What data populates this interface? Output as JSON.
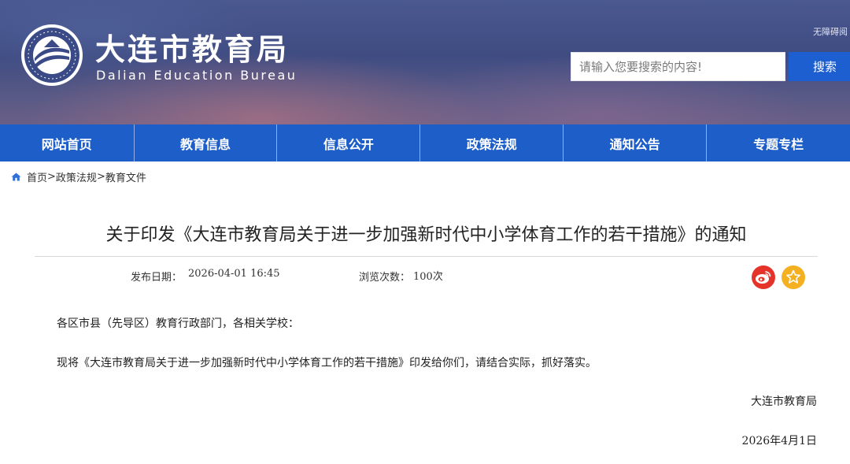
{
  "header": {
    "site_name": "大连市教育局",
    "site_name_en": "Dalian Education Bureau",
    "accessibility_link": "无障碍阅",
    "search": {
      "placeholder": "请输入您要搜索的内容!",
      "button_label": "搜索"
    },
    "banner_color": "#44538a",
    "accent_color": "#1e5ec9"
  },
  "nav": {
    "items": [
      {
        "label": "网站首页"
      },
      {
        "label": "教育信息"
      },
      {
        "label": "信息公开"
      },
      {
        "label": "政策法规"
      },
      {
        "label": "通知公告"
      },
      {
        "label": "专题专栏"
      }
    ]
  },
  "breadcrumb": {
    "icon": "home-icon",
    "items": [
      "首页",
      "政策法规",
      "教育文件"
    ],
    "separator": ">"
  },
  "article": {
    "title": "关于印发《大连市教育局关于进一步加强新时代中小学体育工作的若干措施》的通知",
    "publish_label": "发布日期：",
    "publish_date": "2026-04-01  16:45",
    "views_label": "浏览次数：",
    "views": "100次",
    "share": [
      {
        "icon": "weibo-icon",
        "color": "#e5332a"
      },
      {
        "icon": "star-icon",
        "color": "#f4b021"
      }
    ],
    "greeting": "各区市县（先导区）教育行政部门，各相关学校：",
    "paragraph": "现将《大连市教育局关于进一步加强新时代中小学体育工作的若干措施》印发给你们，请结合实际，抓好落实。",
    "signature": "大连市教育局",
    "signature_date": "2026年4月1日"
  }
}
